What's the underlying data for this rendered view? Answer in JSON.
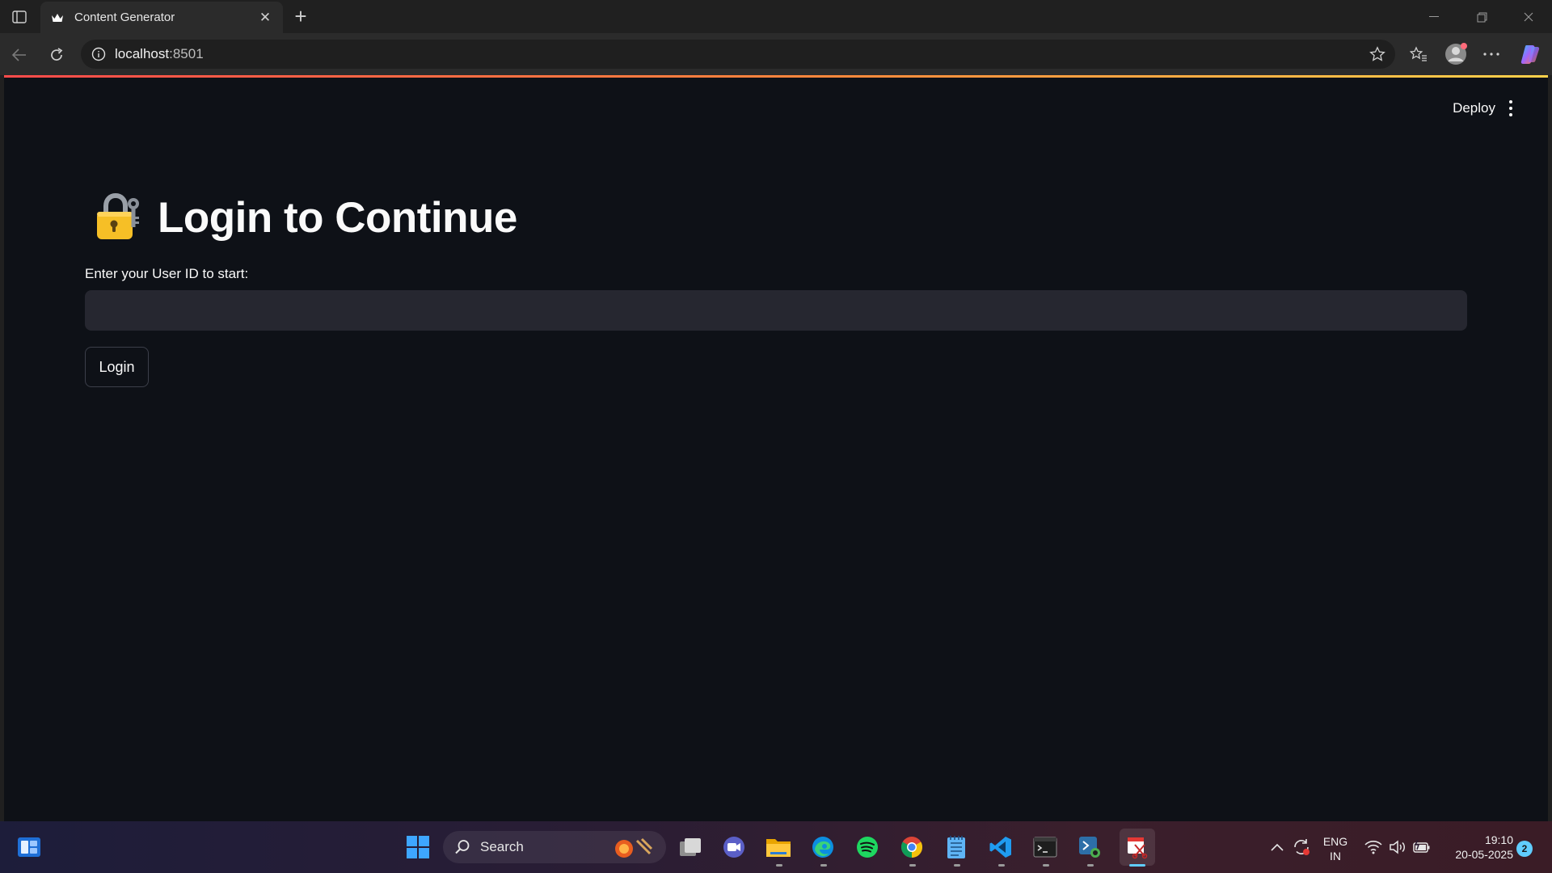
{
  "browser": {
    "tab_title": "Content Generator",
    "url_host": "localhost",
    "url_port": ":8501"
  },
  "app": {
    "deploy_label": "Deploy",
    "title": "Login to Continue",
    "title_icon": "lock-with-key-icon",
    "field_label": "Enter your User ID to start:",
    "field_value": "",
    "login_label": "Login"
  },
  "taskbar": {
    "search_label": "Search",
    "lang_line1": "ENG",
    "lang_line2": "IN",
    "time": "19:10",
    "date": "20-05-2025",
    "notification_count": "2"
  },
  "colors": {
    "app_bg": "#0e1117",
    "input_bg": "#262730",
    "accent_gradient_start": "#ff4b4b",
    "accent_gradient_end": "#ffd24b"
  }
}
